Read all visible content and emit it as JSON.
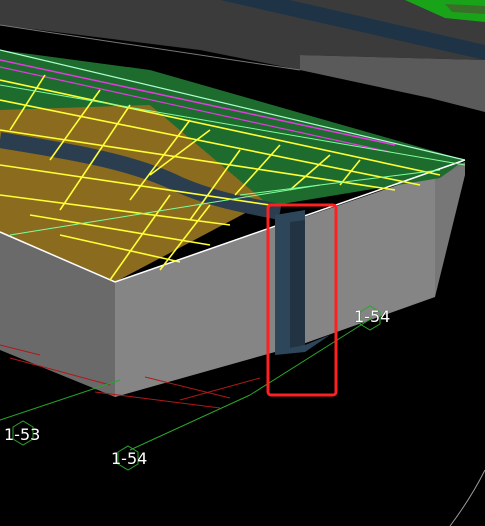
{
  "viewport": {
    "background_color": "#000000",
    "slab_gray": "#8a8a8a",
    "dirt_color": "#8b6b1e",
    "green_area_color": "#1e6b2e",
    "rebar_yellow": "#ffff33",
    "highlight_red": "#ff2020"
  },
  "axis_labels": [
    {
      "text": "1-54"
    },
    {
      "text": "1-53"
    },
    {
      "text": "1-54"
    }
  ],
  "highlight": {
    "description_icon": "selection-rectangle"
  }
}
